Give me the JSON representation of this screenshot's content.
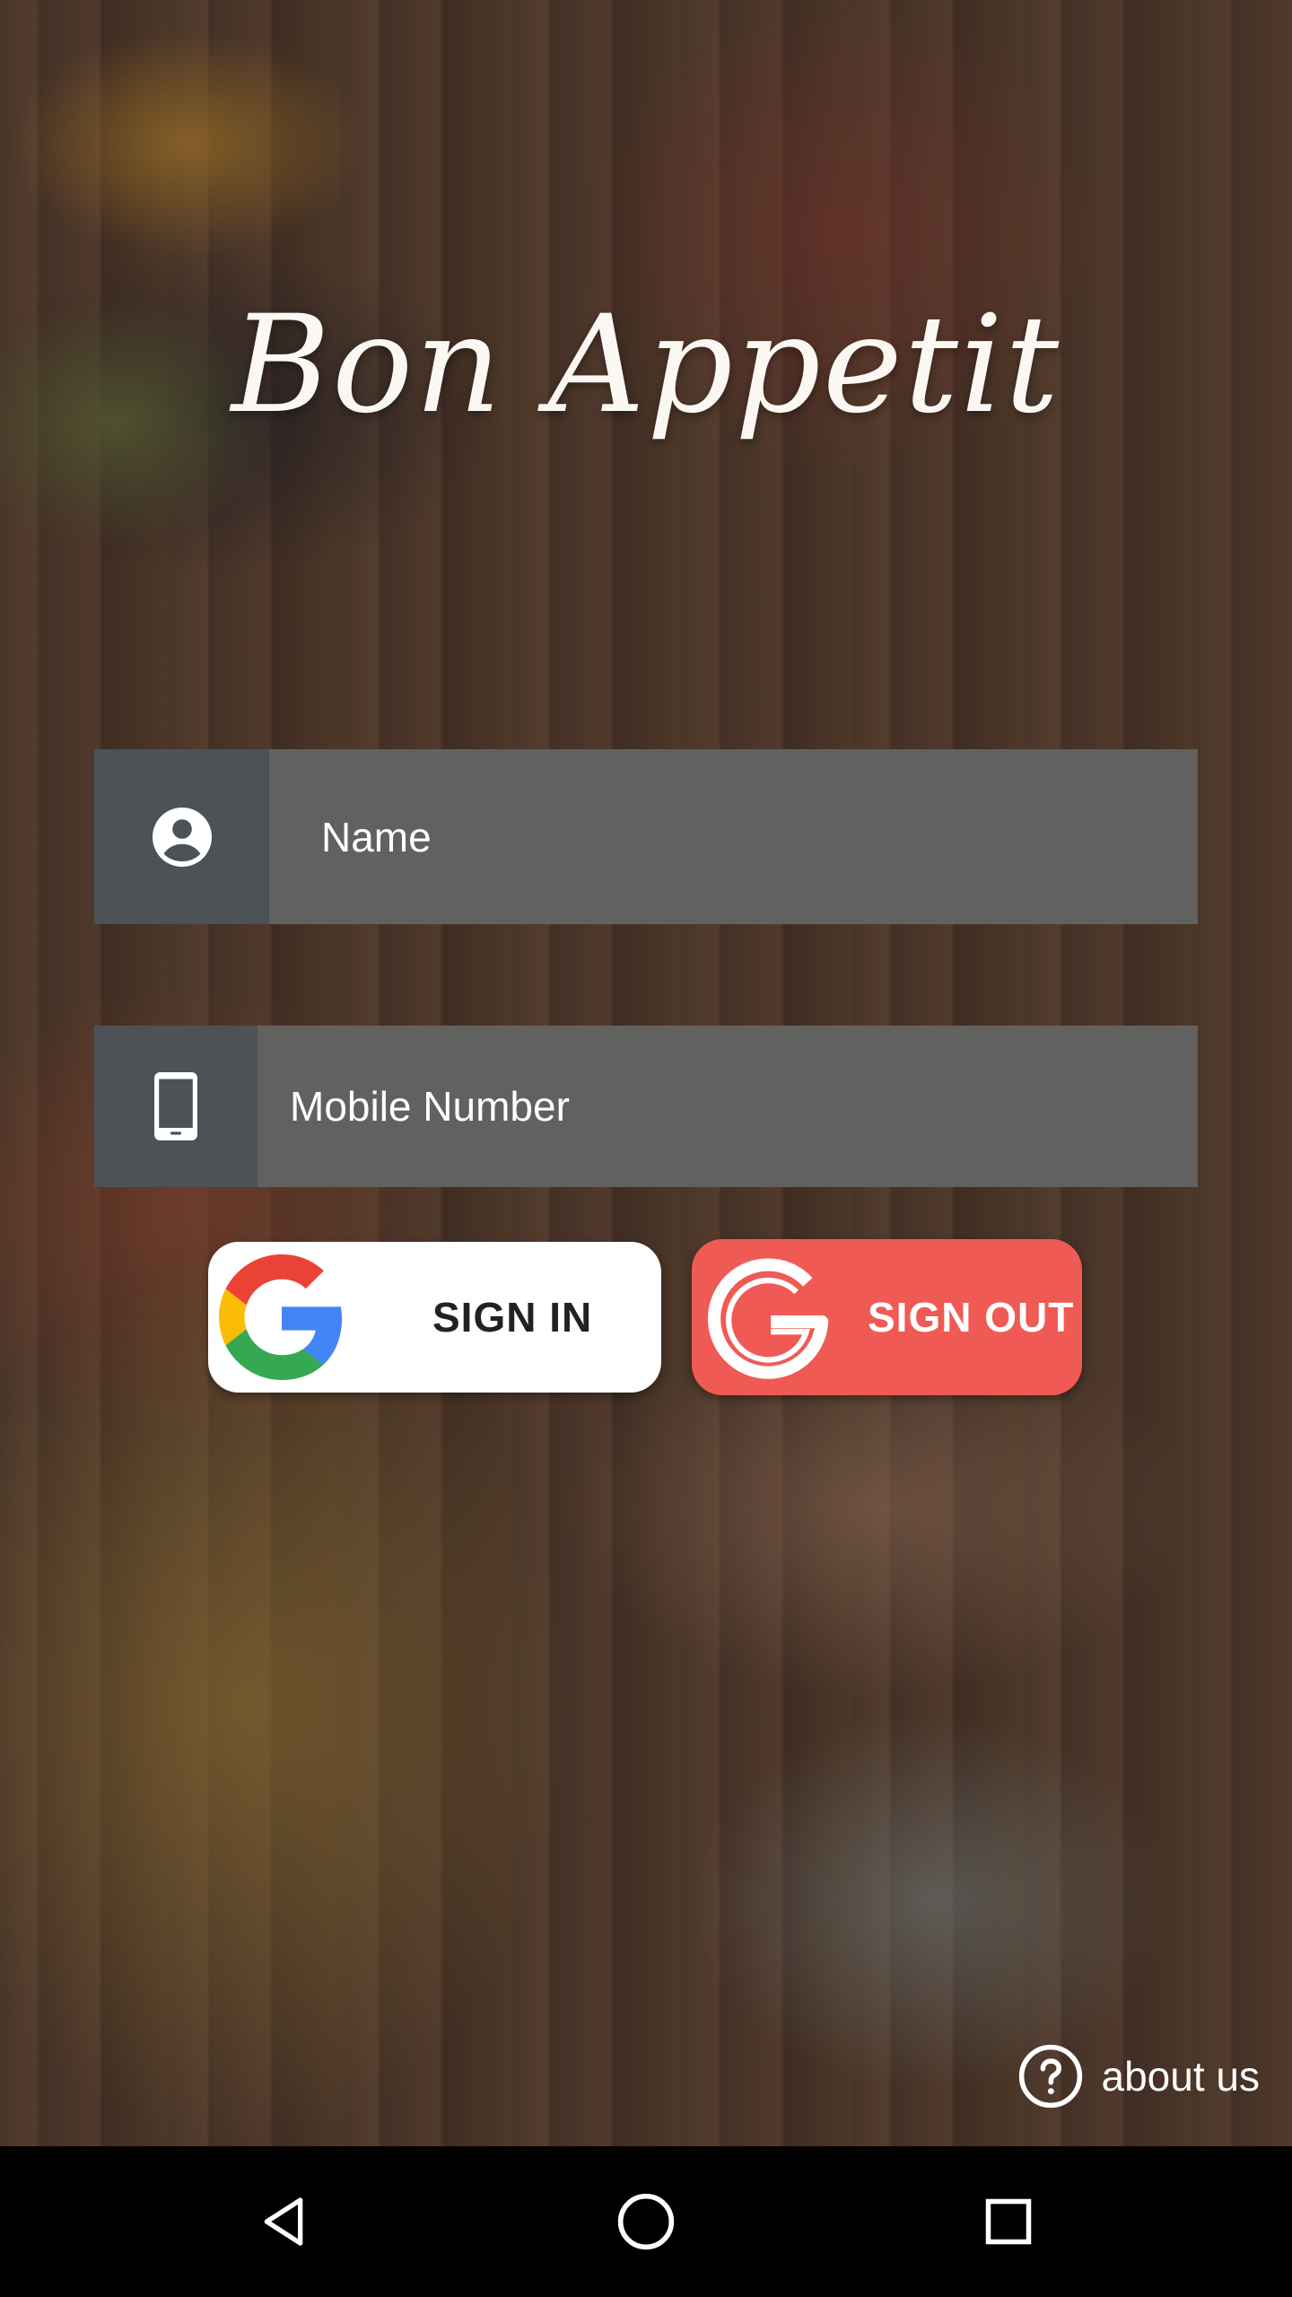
{
  "app": {
    "title": "Bon Appetit"
  },
  "form": {
    "name_placeholder": "Name",
    "mobile_placeholder": "Mobile Number"
  },
  "buttons": {
    "sign_in_label": "SIGN IN",
    "sign_out_label": "SIGN OUT"
  },
  "footer": {
    "about_label": "about us"
  },
  "icons": {
    "name_field": "account-circle-icon",
    "mobile_field": "smartphone-icon",
    "sign_in": "google-logo-icon",
    "sign_out": "google-outline-icon",
    "about": "help-circle-icon",
    "nav_back": "back-triangle-icon",
    "nav_home": "home-circle-icon",
    "nav_recents": "recents-square-icon"
  },
  "colors": {
    "field_background": "#61625f",
    "field_icon_background": "#4c5255",
    "sign_in_background": "#ffffff",
    "sign_out_background": "#ef5a55",
    "text_light": "#ffffff",
    "navbar_background": "#000000"
  }
}
